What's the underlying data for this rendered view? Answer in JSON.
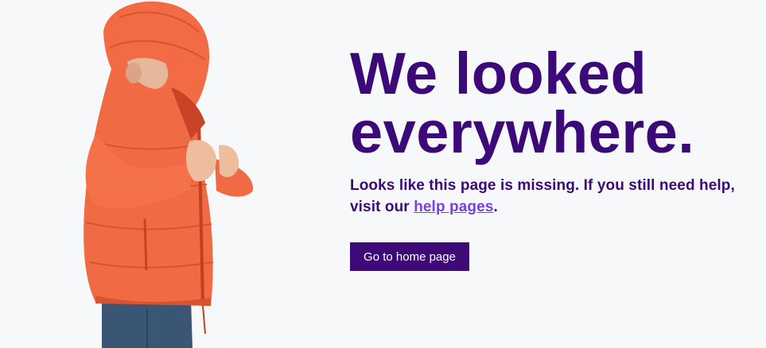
{
  "headline": {
    "line1": "We looked",
    "line2": "everywhere."
  },
  "message": {
    "text_before_link": "Looks like this page is missing. If you still need help, visit our ",
    "link_label": "help pages",
    "text_after_link": "."
  },
  "button": {
    "label": "Go to home page"
  },
  "colors": {
    "background": "#f7f8fa",
    "headline": "#3b0a78",
    "link": "#7a3fe4",
    "button": "#3d0a78",
    "jacket": "#f2683f"
  },
  "image": {
    "icon": "child-in-orange-puffer-jacket-illustration"
  }
}
